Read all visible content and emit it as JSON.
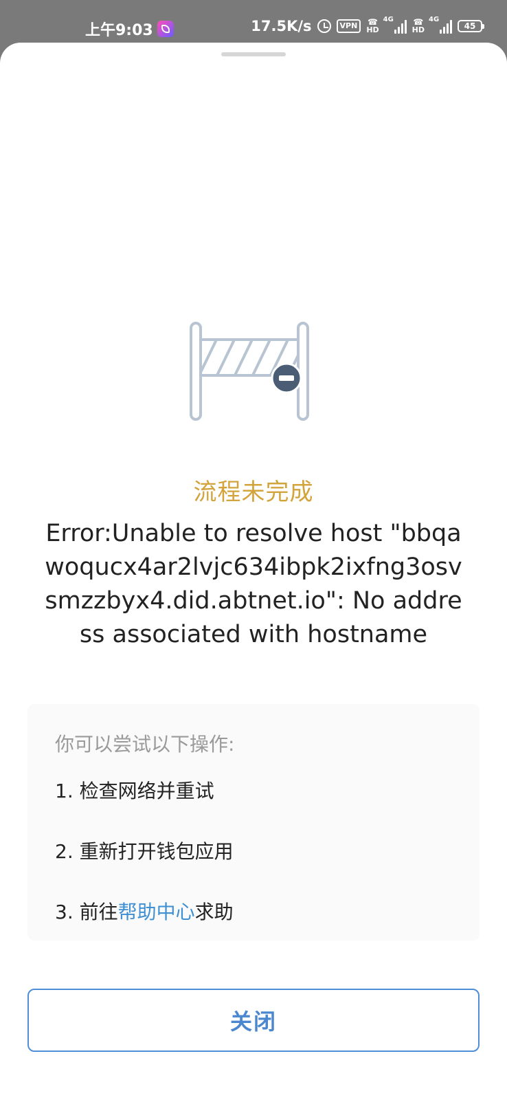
{
  "status_bar": {
    "time": "上午9:03",
    "net_speed": "17.5K/s",
    "vpn": "VPN",
    "hd1": "HD",
    "network1": "4G",
    "hd2": "HD",
    "network2": "4G",
    "battery": "45"
  },
  "sheet": {
    "status_title": "流程未完成",
    "error_message": "Error:Unable to resolve host \"bbqawoqucx4ar2lvjc634ibpk2ixfng3osvsmzzbyx4.did.abtnet.io\": No address associated with hostname",
    "tips": {
      "heading": "你可以尝试以下操作:",
      "item1": "1. 检查网络并重试",
      "item2": "2. 重新打开钱包应用",
      "item3_prefix": "3. 前往",
      "item3_link": "帮助中心",
      "item3_suffix": "求助"
    },
    "close_label": "关闭"
  },
  "colors": {
    "status_title": "#d3a33c",
    "link": "#3f8fd3",
    "button_border": "#4f8ed6",
    "badge": "#4a5d75"
  },
  "icons": {
    "illustration": "barrier-gate-icon",
    "badge": "minus-circle-icon"
  }
}
